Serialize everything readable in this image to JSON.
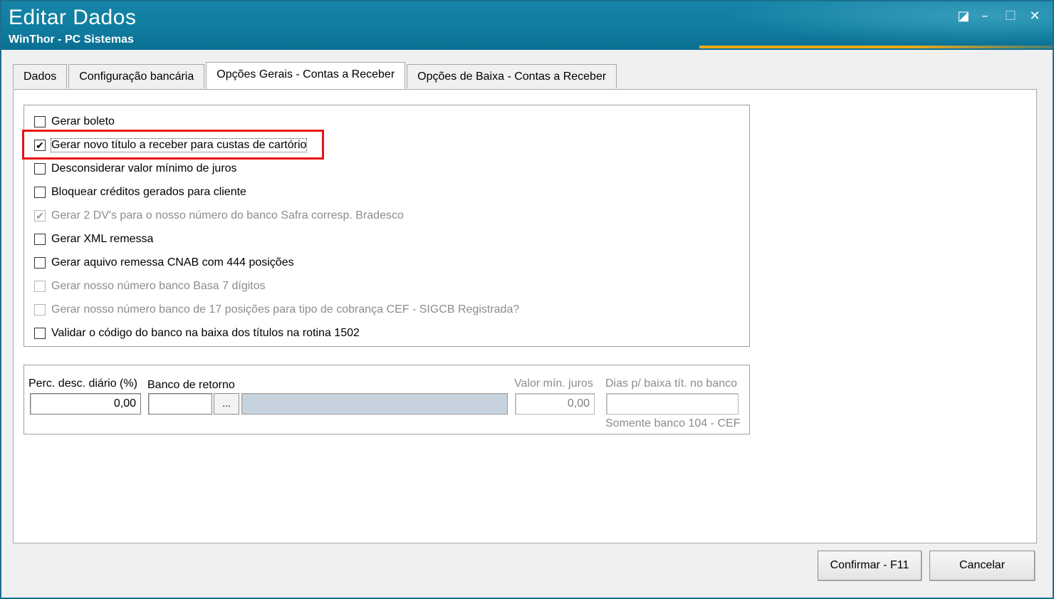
{
  "window": {
    "title": "Editar Dados",
    "subtitle": "WinThor - PC Sistemas",
    "controls": {
      "restore": "◪",
      "minimize": "–",
      "maximize": "☐",
      "close": "✕"
    }
  },
  "tabs": [
    {
      "label": "Dados",
      "active": false
    },
    {
      "label": "Configuração bancária",
      "active": false
    },
    {
      "label": "Opções Gerais - Contas a Receber",
      "active": true
    },
    {
      "label": "Opções de Baixa - Contas a Receber",
      "active": false
    }
  ],
  "options": [
    {
      "label": "Gerar boleto",
      "checked": false,
      "enabled": true
    },
    {
      "label": "Gerar novo título a receber para custas de cartório",
      "checked": true,
      "enabled": true,
      "highlighted": true
    },
    {
      "label": "Desconsiderar valor mínimo de juros",
      "checked": false,
      "enabled": true
    },
    {
      "label": "Bloquear créditos gerados para cliente",
      "checked": false,
      "enabled": true
    },
    {
      "label": "Gerar 2 DV's para o nosso número do banco Safra corresp. Bradesco",
      "checked": true,
      "enabled": false
    },
    {
      "label": "Gerar XML remessa",
      "checked": false,
      "enabled": true
    },
    {
      "label": "Gerar aquivo remessa CNAB com 444 posições",
      "checked": false,
      "enabled": true
    },
    {
      "label": "Gerar nosso número banco Basa 7 dígitos",
      "checked": false,
      "enabled": false
    },
    {
      "label": "Gerar nosso número banco de 17 posições para tipo de cobrança CEF - SIGCB Registrada?",
      "checked": false,
      "enabled": false
    },
    {
      "label": "Validar o código do banco na baixa dos títulos na rotina 1502",
      "checked": false,
      "enabled": true
    }
  ],
  "fields": {
    "perc_desc": {
      "label": "Perc. desc. diário (%)",
      "value": "0,00"
    },
    "banco_retorno": {
      "label": "Banco de retorno",
      "code": "",
      "lookup_label": "...",
      "description": ""
    },
    "valor_min_juros": {
      "label": "Valor mín. juros",
      "value": "0,00"
    },
    "dias_baixa": {
      "label": "Dias p/ baixa tít. no banco",
      "value": "",
      "hint": "Somente banco 104 - CEF"
    }
  },
  "buttons": {
    "confirm": "Confirmar - F11",
    "cancel": "Cancelar"
  },
  "colors": {
    "titlebar": "#0f7ea0",
    "accent_line": "#f0a81a",
    "highlight_border": "#e51414"
  }
}
